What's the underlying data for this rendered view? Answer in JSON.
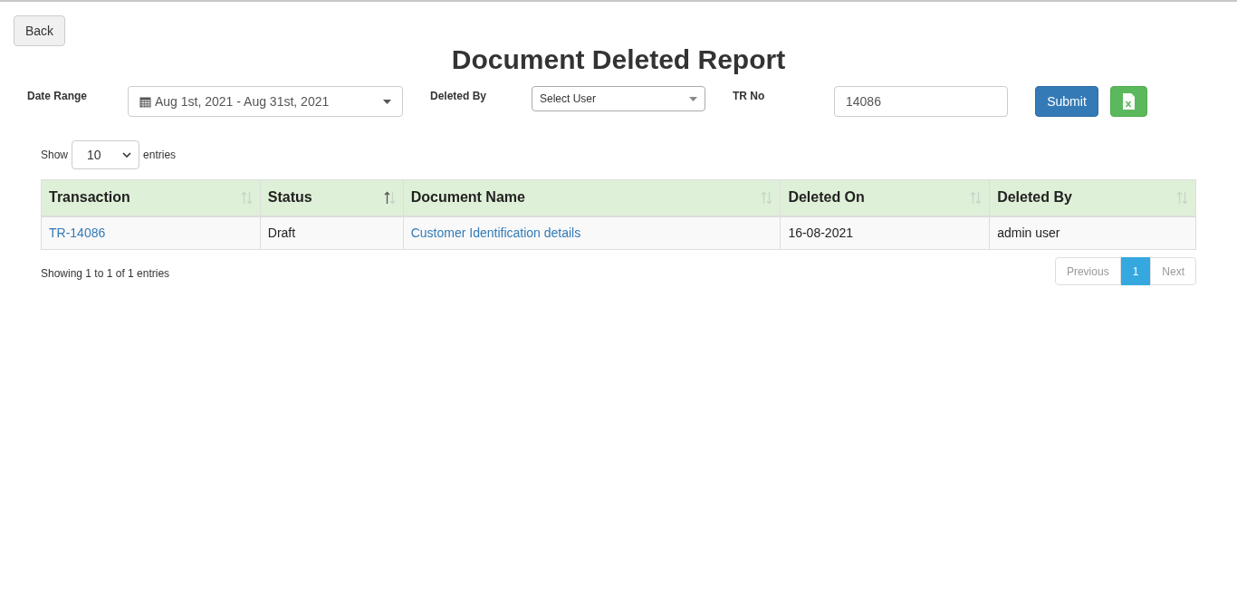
{
  "back_button": "Back",
  "title": "Document Deleted Report",
  "filters": {
    "date_range": {
      "label": "Date Range",
      "value": "Aug 1st, 2021 - Aug 31st, 2021"
    },
    "deleted_by": {
      "label": "Deleted By",
      "value": "Select User"
    },
    "tr_no": {
      "label": "TR No",
      "value": "14086"
    },
    "submit": "Submit"
  },
  "length": {
    "before": "Show",
    "value": "10",
    "after": "entries"
  },
  "table": {
    "columns": [
      {
        "label": "Transaction",
        "sorted": false
      },
      {
        "label": "Status",
        "sorted": true
      },
      {
        "label": "Document Name",
        "sorted": false
      },
      {
        "label": "Deleted On",
        "sorted": false
      },
      {
        "label": "Deleted By",
        "sorted": false
      }
    ],
    "rows": [
      [
        {
          "text": "TR-14086",
          "kind": "link"
        },
        {
          "text": "Draft",
          "kind": "text"
        },
        {
          "text": "Customer Identification details",
          "kind": "link"
        },
        {
          "text": "16-08-2021",
          "kind": "text"
        },
        {
          "text": "admin user",
          "kind": "text"
        }
      ]
    ]
  },
  "info": "Showing 1 to 1 of 1 entries",
  "pagination": [
    {
      "label": "Previous",
      "selected": false,
      "disabled": true
    },
    {
      "label": "1",
      "selected": true,
      "disabled": false
    },
    {
      "label": "Next",
      "selected": false,
      "disabled": true
    }
  ]
}
